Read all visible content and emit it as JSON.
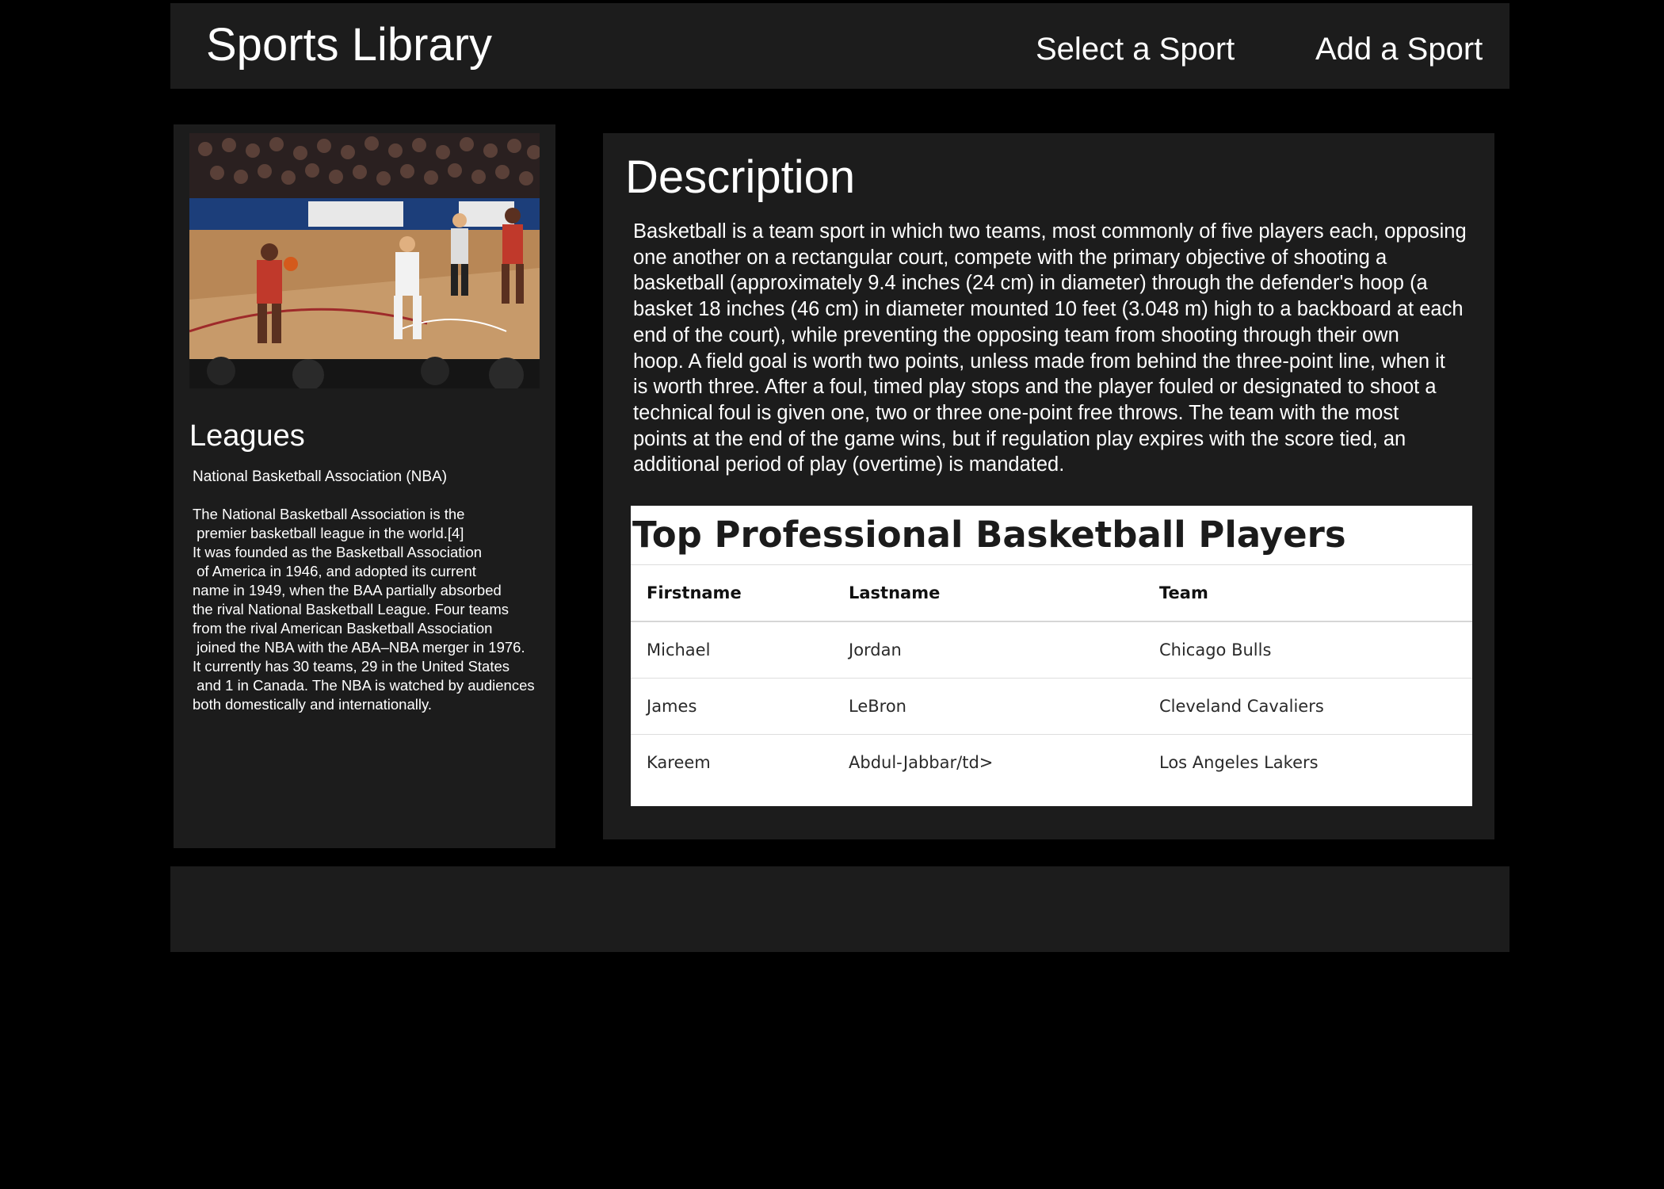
{
  "header": {
    "brand": "Sports Library",
    "nav": {
      "select_sport": "Select a Sport",
      "add_sport": "Add a Sport"
    }
  },
  "sidebar": {
    "leagues_title": "Leagues",
    "league_name": "National Basketball Association (NBA)",
    "league_description_lines": [
      "The National Basketball Association is the",
      " premier basketball league in the world.[4]",
      "It was founded as the Basketball Association",
      " of America in 1946, and adopted its current",
      "name in 1949, when the BAA partially absorbed",
      "the rival National Basketball League. Four teams",
      "from the rival American Basketball Association",
      " joined the NBA with the ABA–NBA merger in 1976.",
      "It currently has 30 teams, 29 in the United States",
      " and 1 in Canada. The NBA is watched by audiences",
      "both domestically and internationally."
    ]
  },
  "main": {
    "description_title": "Description",
    "description_lines": [
      "Basketball is a team sport in which two teams, most commonly of five players each, opposing",
      "one another on a rectangular court, compete with the primary objective of shooting a",
      "basketball (approximately 9.4 inches (24 cm) in diameter) through the defender's hoop (a",
      "basket 18 inches (46 cm) in diameter mounted 10 feet (3.048 m) high to a backboard at each",
      "end of the court), while preventing the opposing team from shooting through their own",
      "hoop. A field goal is worth two points, unless made from behind the three-point line, when it",
      "is worth three. After a foul, timed play stops and the player fouled or designated to shoot a",
      "technical foul is given one, two or three one-point free throws. The team with the most",
      "points at the end of the game wins, but if regulation play expires with the score tied, an",
      "additional period of play (overtime) is mandated."
    ],
    "table": {
      "title": "Top Professional Basketball Players",
      "headers": [
        "Firstname",
        "Lastname",
        "Team"
      ],
      "rows": [
        [
          "Michael",
          "Jordan",
          "Chicago Bulls"
        ],
        [
          "James",
          "LeBron",
          "Cleveland Cavaliers"
        ],
        [
          "Kareem",
          "Abdul-Jabbar/td>",
          "Los Angeles Lakers"
        ]
      ]
    }
  },
  "colors": {
    "page_background": "#000000",
    "panel_background": "#1c1c1c",
    "text": "#ffffff",
    "table_background": "#ffffff"
  }
}
